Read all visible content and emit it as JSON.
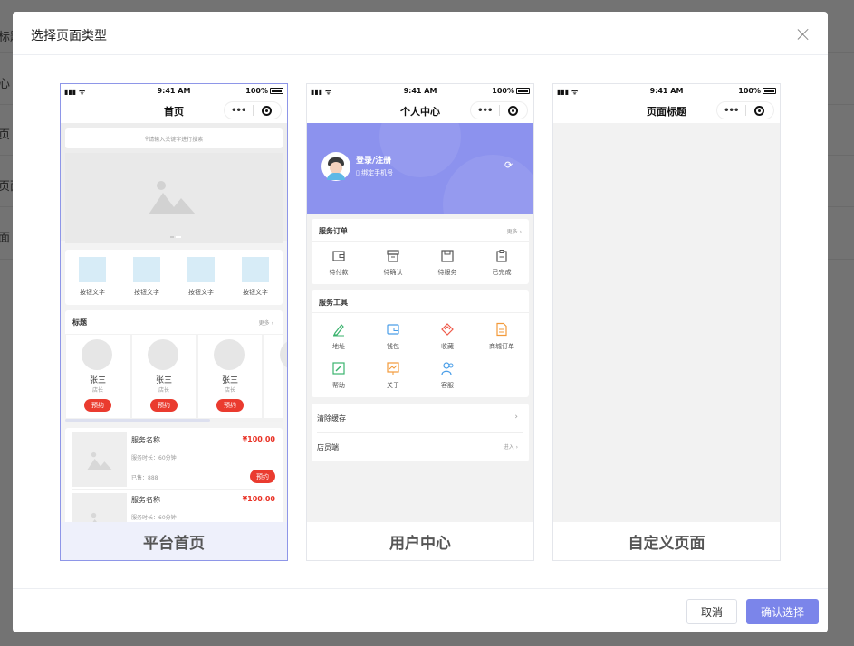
{
  "background": {
    "rows": [
      "标题",
      "心 (",
      "页 (",
      "页面",
      "面 ("
    ]
  },
  "modal": {
    "title": "选择页面类型",
    "cancel_label": "取消",
    "confirm_label": "确认选择"
  },
  "status_bar": {
    "time": "9:41 AM",
    "battery": "100%"
  },
  "capsule": {
    "dots": "•••"
  },
  "cards": [
    {
      "caption": "平台首页",
      "nav_title": "首页",
      "search_placeholder": "请输入关键字进行搜索",
      "buttons": [
        "按钮文字",
        "按钮文字",
        "按钮文字",
        "按钮文字"
      ],
      "section_title": "标题",
      "more": "更多",
      "staff": [
        {
          "name": "张三",
          "role": "店长",
          "action": "预约"
        },
        {
          "name": "张三",
          "role": "店长",
          "action": "预约"
        },
        {
          "name": "张三",
          "role": "店长",
          "action": "预约"
        }
      ],
      "services": [
        {
          "name": "服务名称",
          "price": "¥100.00",
          "duration": "服务时长：60分钟",
          "sold": "已售：888",
          "action": "预约"
        },
        {
          "name": "服务名称",
          "price": "¥100.00",
          "duration": "服务时长：60分钟"
        }
      ]
    },
    {
      "caption": "用户中心",
      "nav_title": "个人中心",
      "login": "登录/注册",
      "bind_phone": "绑定手机号",
      "orders_title": "服务订单",
      "orders_more": "更多",
      "orders": [
        "待付款",
        "待确认",
        "待服务",
        "已完成"
      ],
      "tools_title": "服务工具",
      "tools": [
        "地址",
        "钱包",
        "收藏",
        "商城订单",
        "帮助",
        "关于",
        "客服"
      ],
      "menu": [
        {
          "label": "清除缓存",
          "value": ""
        },
        {
          "label": "店员端",
          "value": "进入"
        }
      ]
    },
    {
      "caption": "自定义页面",
      "nav_title": "页面标题"
    }
  ]
}
